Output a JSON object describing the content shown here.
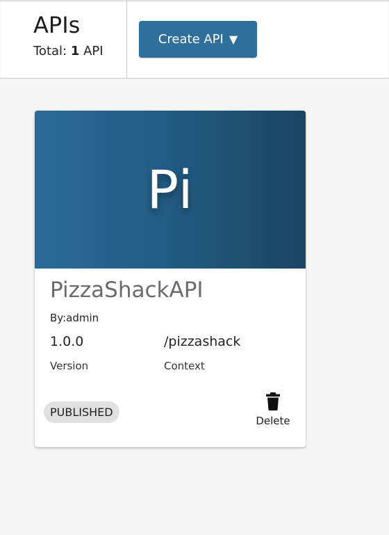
{
  "header": {
    "title": "APIs",
    "total_label": "Total:",
    "total_count": "1",
    "total_unit": "API",
    "create_button": "Create API",
    "create_caret": "▼"
  },
  "api_card": {
    "thumbnail_text": "Pi",
    "name": "PizzaShackAPI",
    "by": "By:admin",
    "version_value": "1.0.0",
    "version_label": "Version",
    "context_value": "/pizzashack",
    "context_label": "Context",
    "status": "PUBLISHED",
    "delete_label": "Delete",
    "delete_icon": "trash-icon",
    "thumbnail_colors": [
      "#2c6b98",
      "#1a4561"
    ]
  },
  "colors": {
    "primary": "#2f6f9a",
    "background": "#f5f5f5",
    "chip": "#e0e0e0"
  }
}
